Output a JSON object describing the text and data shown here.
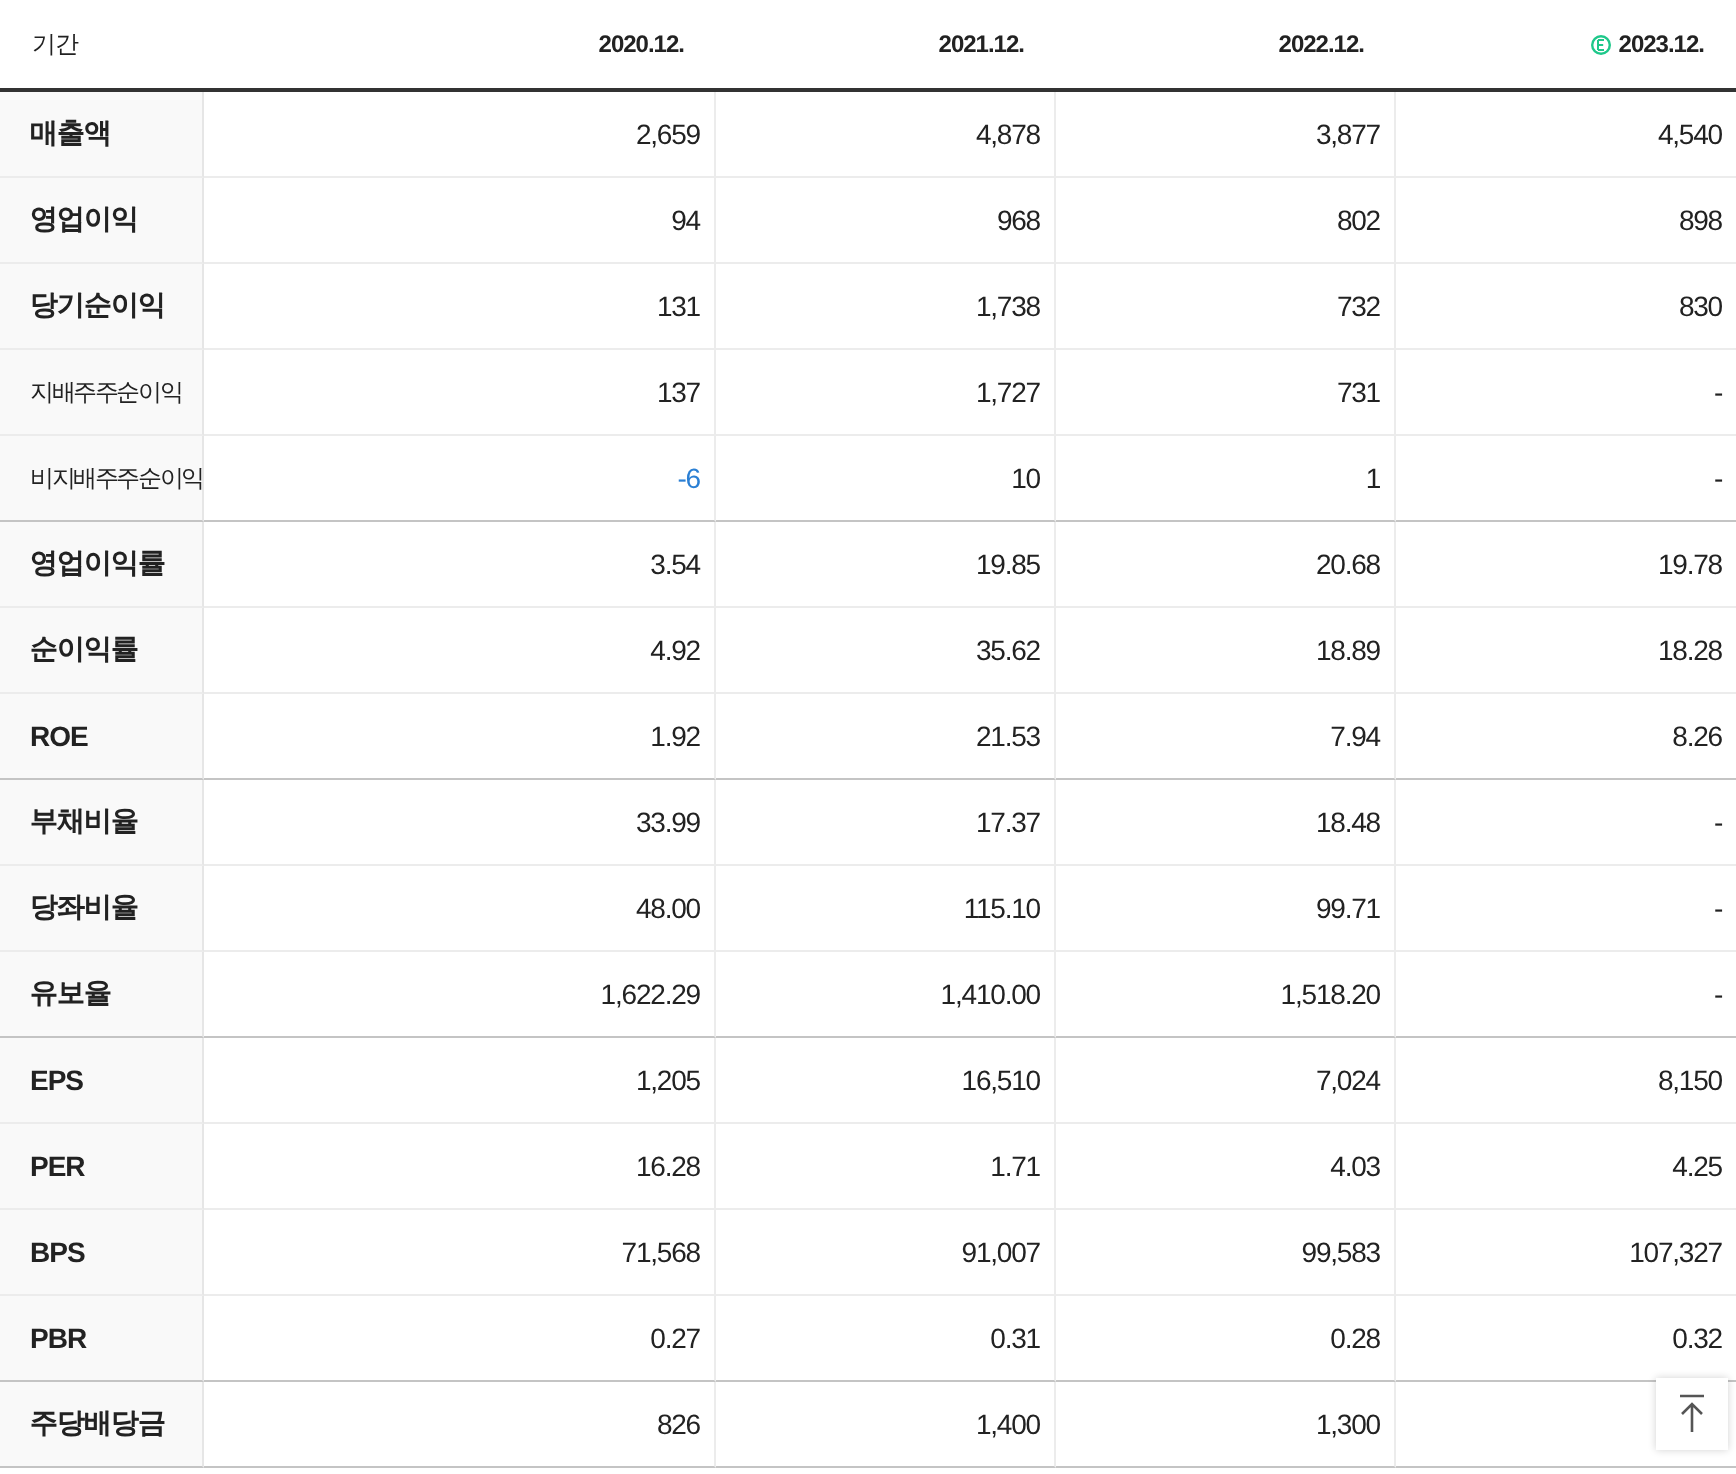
{
  "header": {
    "label": "기간",
    "columns": [
      {
        "text": "2020.12.",
        "estimate": false
      },
      {
        "text": "2021.12.",
        "estimate": false
      },
      {
        "text": "2022.12.",
        "estimate": false
      },
      {
        "text": "2023.12.",
        "estimate": true
      }
    ]
  },
  "groups": [
    {
      "rows": [
        {
          "label": "매출액",
          "kind": "main",
          "values": [
            "2,659",
            "4,878",
            "3,877",
            "4,540"
          ]
        },
        {
          "label": "영업이익",
          "kind": "main",
          "values": [
            "94",
            "968",
            "802",
            "898"
          ]
        },
        {
          "label": "당기순이익",
          "kind": "main",
          "values": [
            "131",
            "1,738",
            "732",
            "830"
          ]
        },
        {
          "label": "지배주주순이익",
          "kind": "sub",
          "values": [
            "137",
            "1,727",
            "731",
            "-"
          ]
        },
        {
          "label": "비지배주주순이익",
          "kind": "sub",
          "values": [
            {
              "text": "-6",
              "negative": true
            },
            "10",
            "1",
            "-"
          ]
        }
      ]
    },
    {
      "rows": [
        {
          "label": "영업이익률",
          "kind": "main",
          "values": [
            "3.54",
            "19.85",
            "20.68",
            "19.78"
          ]
        },
        {
          "label": "순이익률",
          "kind": "main",
          "values": [
            "4.92",
            "35.62",
            "18.89",
            "18.28"
          ]
        },
        {
          "label": "ROE",
          "kind": "main",
          "values": [
            "1.92",
            "21.53",
            "7.94",
            "8.26"
          ]
        }
      ]
    },
    {
      "rows": [
        {
          "label": "부채비율",
          "kind": "main",
          "values": [
            "33.99",
            "17.37",
            "18.48",
            "-"
          ]
        },
        {
          "label": "당좌비율",
          "kind": "main",
          "values": [
            "48.00",
            "115.10",
            "99.71",
            "-"
          ]
        },
        {
          "label": "유보율",
          "kind": "main",
          "values": [
            "1,622.29",
            "1,410.00",
            "1,518.20",
            "-"
          ]
        }
      ]
    },
    {
      "rows": [
        {
          "label": "EPS",
          "kind": "main",
          "values": [
            "1,205",
            "16,510",
            "7,024",
            "8,150"
          ]
        },
        {
          "label": "PER",
          "kind": "main",
          "values": [
            "16.28",
            "1.71",
            "4.03",
            "4.25"
          ]
        },
        {
          "label": "BPS",
          "kind": "main",
          "values": [
            "71,568",
            "91,007",
            "99,583",
            "107,327"
          ]
        },
        {
          "label": "PBR",
          "kind": "main",
          "values": [
            "0.27",
            "0.31",
            "0.28",
            "0.32"
          ]
        }
      ]
    },
    {
      "rows": [
        {
          "label": "주당배당금",
          "kind": "main",
          "values": [
            "826",
            "1,400",
            "1,300"
          ]
        }
      ]
    }
  ]
}
